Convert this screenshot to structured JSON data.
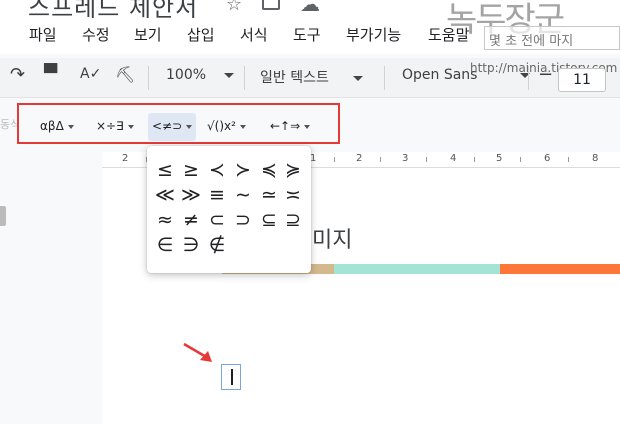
{
  "document": {
    "title": "스프레드 제안서"
  },
  "menu": {
    "items": [
      "파일",
      "수정",
      "보기",
      "삽입",
      "서식",
      "도구",
      "부가기능",
      "도움말"
    ],
    "hint": "몇 초 전에 마지"
  },
  "watermark": {
    "logo": "녹두장군",
    "url": "http://mainia.tistory.com"
  },
  "toolbar": {
    "zoom": "100%",
    "style": "일반 텍스트",
    "font": "Open Sans",
    "font_size": "11",
    "minus": "−"
  },
  "equation_toolbar": {
    "ghost_label": "동식",
    "buttons": [
      {
        "label": "αβΔ",
        "name": "greek-letters"
      },
      {
        "label": "×÷∃",
        "name": "misc-operations"
      },
      {
        "label": "<≠⊃",
        "name": "relations",
        "active": true
      },
      {
        "label": "√()x²",
        "name": "math-operators"
      },
      {
        "label": "←↑⇒",
        "name": "arrows"
      }
    ]
  },
  "ruler": {
    "labels": [
      "2",
      "1",
      "1",
      "2",
      "3",
      "4",
      "5",
      "6",
      "7",
      "8"
    ]
  },
  "relations_menu": {
    "symbols": [
      [
        "≤",
        "≥",
        "≺",
        "≻",
        "≼",
        "≽"
      ],
      [
        "≪",
        "≫",
        "≡",
        "∼",
        "≃",
        "≍"
      ],
      [
        "≈",
        "≠",
        "⊂",
        "⊃",
        "⊆",
        "⊇"
      ],
      [
        "∈",
        "∋",
        "∉"
      ]
    ]
  },
  "page": {
    "heading": "미지"
  },
  "colors": {
    "tan": "#d4b98d",
    "teal": "#a3e4d7",
    "orange": "#ff7738",
    "highlight": "#e53935"
  }
}
